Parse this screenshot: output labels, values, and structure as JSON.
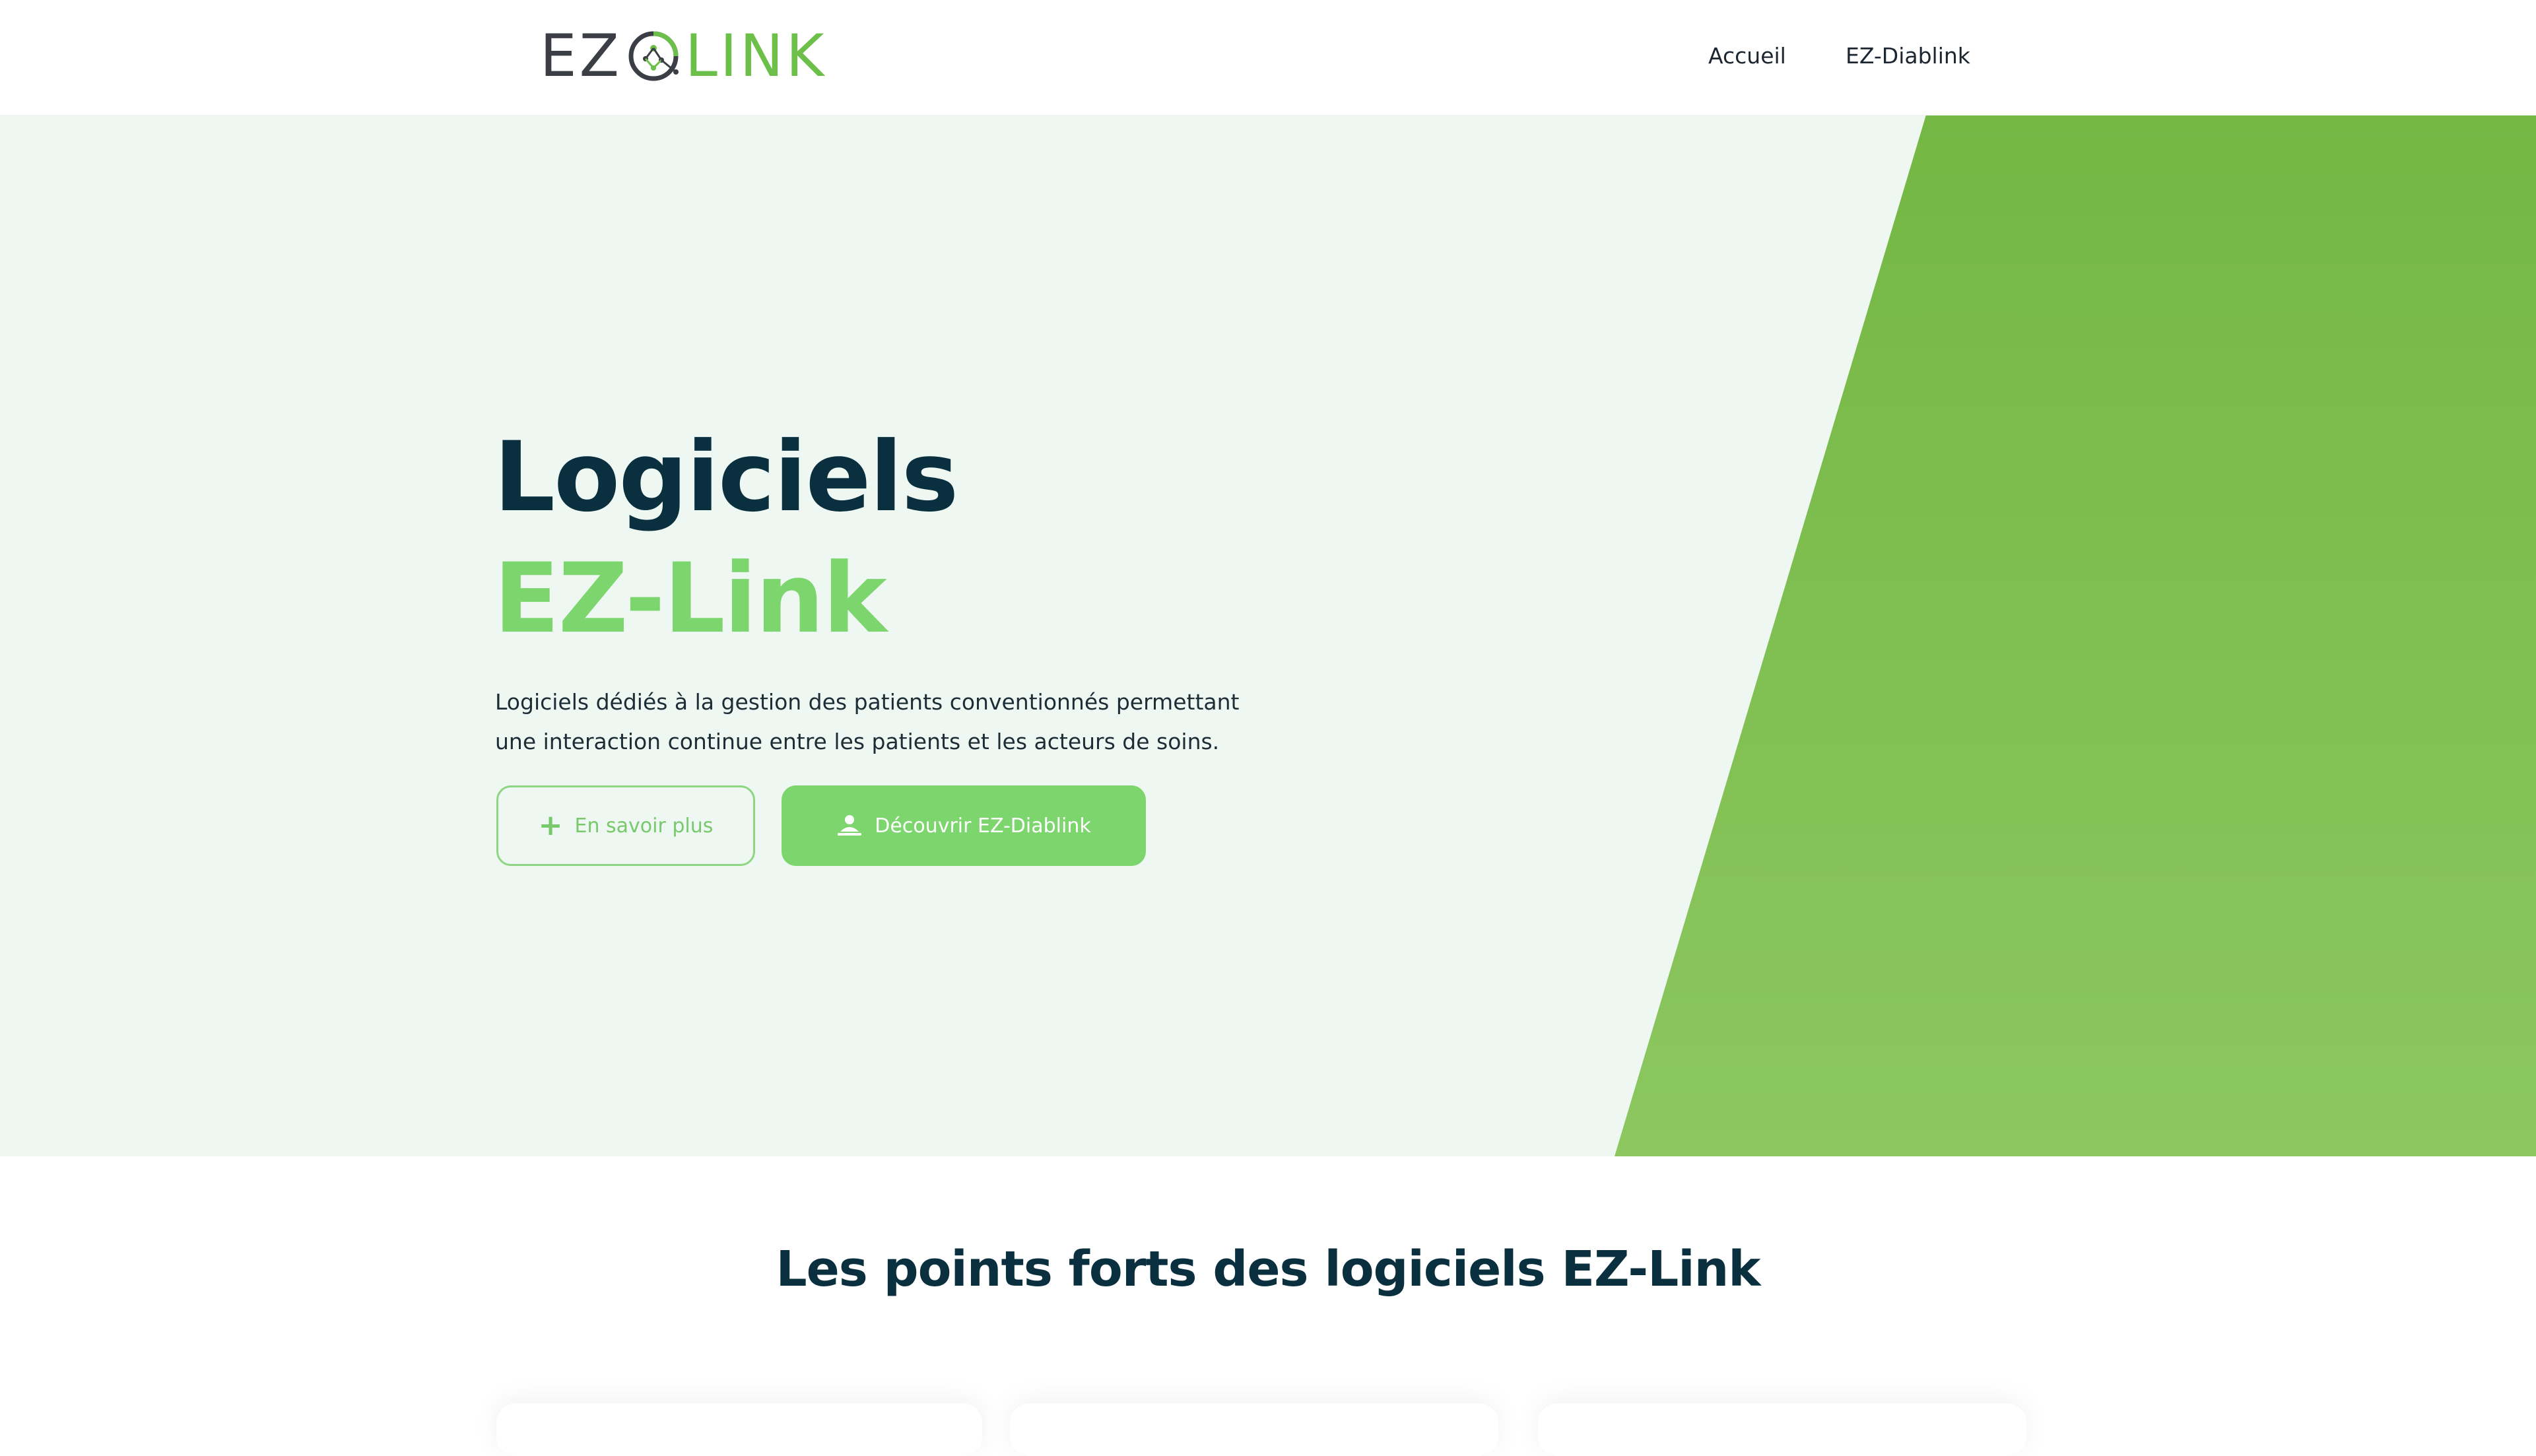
{
  "header": {
    "logo": {
      "left_text": "EZ",
      "right_text": "LINK"
    },
    "nav": [
      {
        "label": "Accueil"
      },
      {
        "label": "EZ-Diablink"
      }
    ]
  },
  "hero": {
    "title_line1": "Logiciels",
    "title_line2": "EZ-Link",
    "description": "Logiciels dédiés à la gestion des patients conventionnés permettant une interaction continue entre les patients et les acteurs de soins.",
    "buttons": {
      "learn_more": {
        "label": "En savoir plus",
        "icon": "plus-icon"
      },
      "discover": {
        "label": "Découvrir EZ-Diablink",
        "icon": "patient-icon"
      }
    }
  },
  "features": {
    "title": "Les points forts des logiciels EZ-Link",
    "cards_visible": 3
  },
  "colors": {
    "brand_green": "#7dd66d",
    "dark_navy": "#0a3040",
    "hero_bg": "#eff7f2",
    "green_panel_top": "#74b743",
    "green_panel_bottom": "#8cc760"
  }
}
